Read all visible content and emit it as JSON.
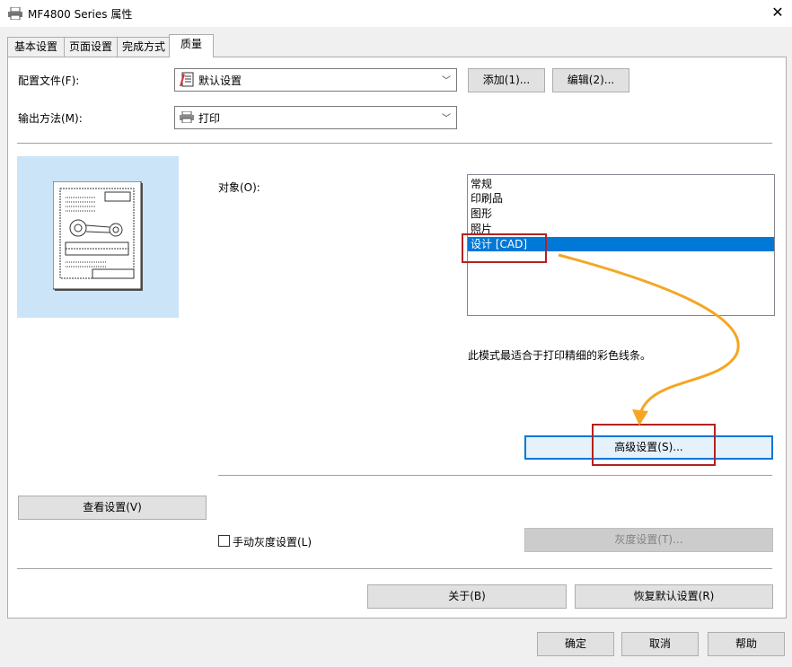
{
  "window": {
    "title": "MF4800 Series 属性",
    "close": "✕"
  },
  "tabs": [
    {
      "label": "基本设置"
    },
    {
      "label": "页面设置"
    },
    {
      "label": "完成方式"
    },
    {
      "label": "质量"
    }
  ],
  "profile": {
    "label": "配置文件(F):",
    "value": "默认设置",
    "add_button": "添加(1)...",
    "edit_button": "编辑(2)..."
  },
  "output": {
    "label": "输出方法(M):",
    "value": "打印"
  },
  "object": {
    "label": "对象(O):",
    "items": [
      "常规",
      "印刷品",
      "图形",
      "照片",
      "设计 [CAD]"
    ],
    "selected_index": 4,
    "description": "此模式最适合于打印精细的彩色线条。"
  },
  "buttons": {
    "advanced": "高级设置(S)...",
    "view_settings": "查看设置(V)",
    "gray_settings": "灰度设置(T)...",
    "about": "关于(B)",
    "restore_defaults": "恢复默认设置(R)",
    "ok": "确定",
    "cancel": "取消",
    "help": "帮助"
  },
  "manual_gray": {
    "label": "手动灰度设置(L)",
    "checked": false
  },
  "colors": {
    "accent": "#0078d7",
    "highlight_box": "#b22222",
    "arrow": "#f5a623",
    "preview_bg": "#cce4f7"
  }
}
